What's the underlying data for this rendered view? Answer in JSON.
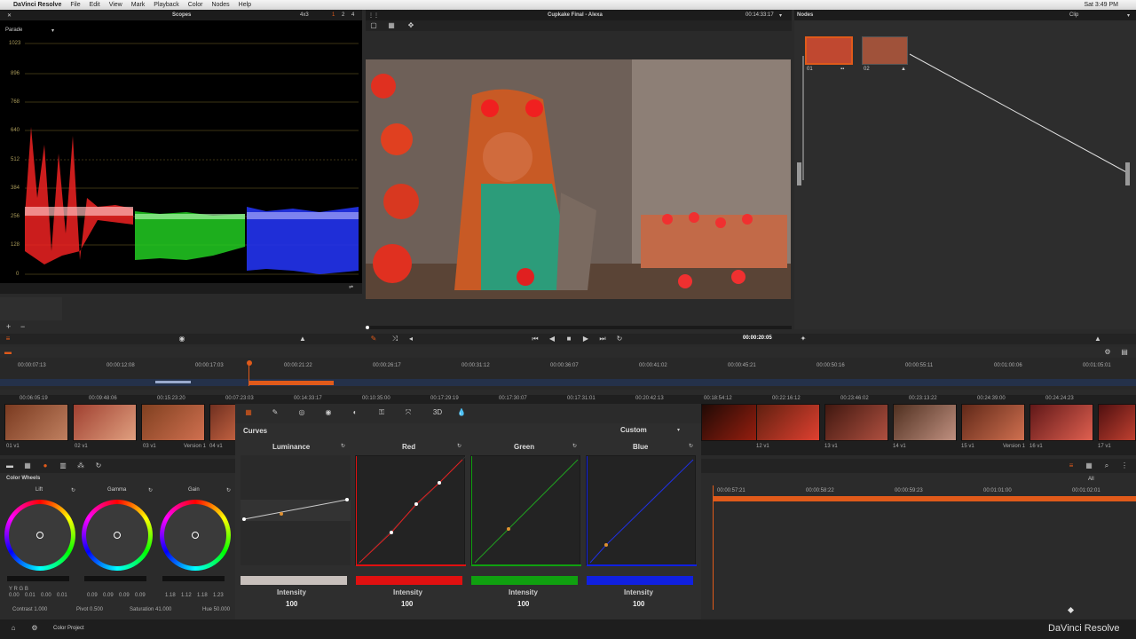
{
  "menubar": {
    "app": "DaVinci Resolve",
    "items": [
      "File",
      "Edit",
      "View",
      "Mark",
      "Playback",
      "Color",
      "Nodes",
      "Help"
    ],
    "clock": "Sat 3:49 PM"
  },
  "scopes": {
    "title": "Scopes",
    "mode": "Parade",
    "layout": "4x3",
    "layout_nums": [
      "1",
      "2",
      "4"
    ],
    "ticks": [
      "1023",
      "896",
      "768",
      "640",
      "512",
      "384",
      "256",
      "128",
      "0"
    ]
  },
  "viewer": {
    "title": "Cupkake Final - Alexa",
    "timecode": "00:14:33:17",
    "playhead_tc": "00:00:20:05"
  },
  "nodes": {
    "title": "Nodes",
    "mode": "Clip",
    "node1": "01",
    "node2": "02"
  },
  "timeline": {
    "ruler": [
      "00:00:07:13",
      "00:00:12:08",
      "00:00:17:03",
      "00:00:21:22",
      "00:00:26:17",
      "00:00:31:12",
      "00:00:36:07",
      "00:00:41:02",
      "00:00:45:21",
      "00:00:50:16",
      "00:00:55:11",
      "00:01:00:06",
      "00:01:05:01"
    ]
  },
  "clips": {
    "timecodes": [
      "00:06:05:19",
      "00:09:48:06",
      "00:15:23:20",
      "00:07:23:03",
      "00:14:33:17",
      "00:10:35:00",
      "00:17:29:19",
      "00:17:30:07",
      "00:17:31:01",
      "00:20:42:13",
      "00:18:54:12",
      "00:22:16:12",
      "00:23:46:02",
      "00:23:13:22",
      "00:24:39:00",
      "00:24:24:23"
    ],
    "left_labels": [
      "01 v1",
      "02 v1",
      "03 v1",
      "04 v1"
    ],
    "right_labels": [
      "12 v1",
      "13 v1",
      "14 v1",
      "15 v1",
      "16 v1",
      "17 v1"
    ],
    "version_left": "Version 1",
    "version_right": "Version 1"
  },
  "wheels": {
    "title": "Color Wheels",
    "lift": "Lift",
    "gamma": "Gamma",
    "gain": "Gain",
    "lift_vals": [
      "0.00",
      "0.01",
      "0.00",
      "0.01"
    ],
    "gamma_vals": [
      "0.09",
      "0.09",
      "0.09",
      "0.09"
    ],
    "gain_vals": [
      "1.18",
      "1.12",
      "1.18",
      "1.23"
    ],
    "contrast": "Contrast 1.000",
    "pivot": "Pivot 0.500",
    "saturation": "Saturation 41.000",
    "hue": "Hue 50.000"
  },
  "curves": {
    "title": "Curves",
    "mode": "Custom",
    "luminance": "Luminance",
    "red": "Red",
    "green": "Green",
    "blue": "Blue",
    "intensity_label": "Intensity",
    "intensity_lum": "100",
    "intensity_red": "100",
    "intensity_green": "100",
    "intensity_blue": "100"
  },
  "keyframes": {
    "mode": "All",
    "ruler": [
      "00:00:57:21",
      "00:00:58:22",
      "00:00:59:23",
      "00:01:01:00",
      "00:01:02:01"
    ]
  },
  "bottom": {
    "project": "Color Project",
    "brand": "DaVinci Resolve"
  },
  "colors": {
    "accent": "#e05a1a",
    "red": "#e01010",
    "green": "#10a010",
    "blue": "#1020e0"
  }
}
